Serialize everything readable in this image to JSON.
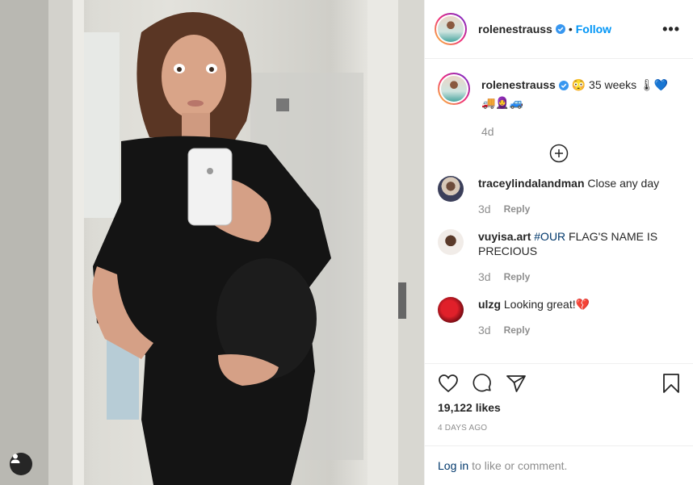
{
  "post": {
    "author": "rolenestrauss",
    "follow_label": "Follow",
    "dot": "•",
    "more_label": "•••"
  },
  "caption": {
    "username": "rolenestrauss",
    "text": "😳 35 weeks 🌡💙",
    "text_line2": "🚚🧕🚙",
    "time": "4d"
  },
  "comments": [
    {
      "username": "traceylindalandman",
      "text": "Close any day",
      "time": "3d",
      "reply_label": "Reply"
    },
    {
      "username": "vuyisa.art",
      "hashtag": "#OUR",
      "text": " FLAG'S NAME IS PRECIOUS",
      "time": "3d",
      "reply_label": "Reply"
    },
    {
      "username": "ulzg",
      "text": "Looking great!💔",
      "time": "3d",
      "reply_label": "Reply"
    }
  ],
  "stats": {
    "likes": "19,122 likes",
    "date": "4 DAYS AGO"
  },
  "login": {
    "link": "Log in",
    "text": "to like or comment."
  },
  "colors": {
    "accent": "#0095f6",
    "link": "#00376b",
    "muted": "#8e8e8e",
    "text": "#262626"
  },
  "icons": [
    "verified-badge-icon",
    "more-options-icon",
    "load-more-comments-icon",
    "heart-icon",
    "comment-icon",
    "share-icon",
    "bookmark-icon",
    "user-tag-icon"
  ]
}
